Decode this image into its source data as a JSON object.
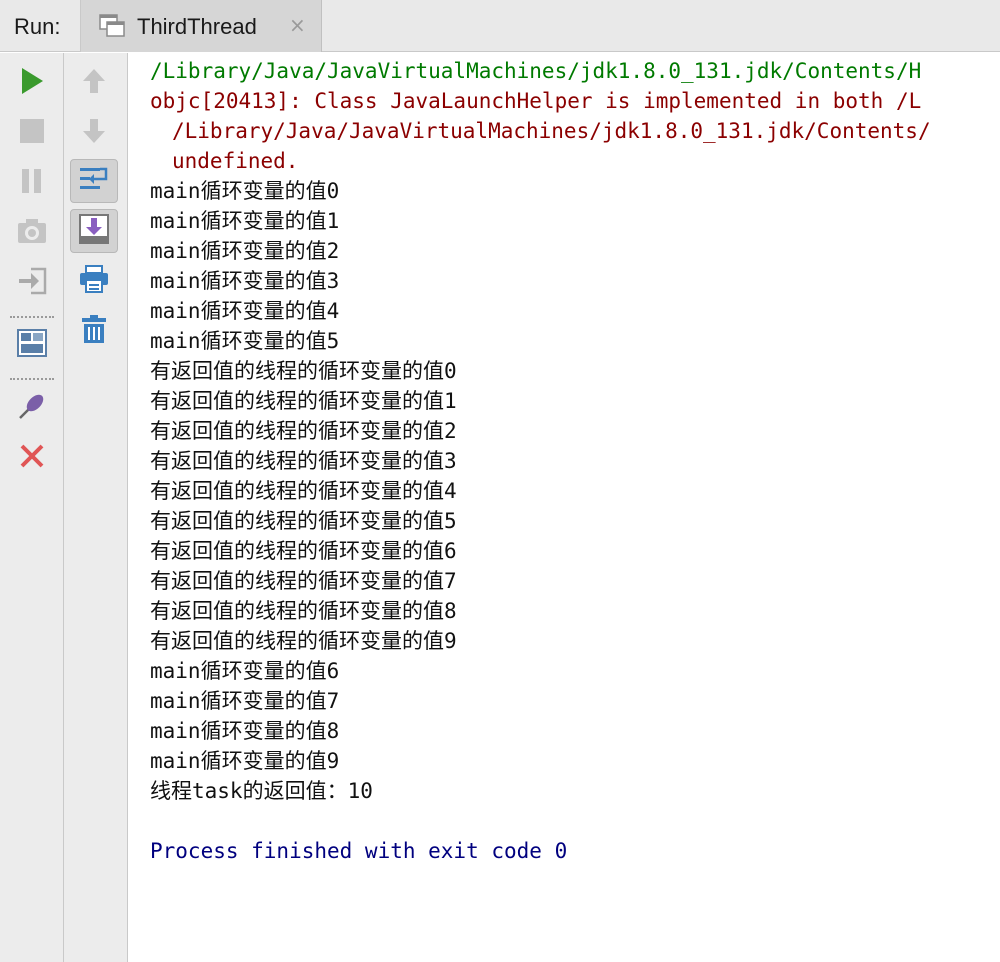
{
  "header": {
    "run_label": "Run:",
    "tab_title": "ThirdThread",
    "tab_close": "×",
    "tab_icon": "run-config-icon"
  },
  "toolbar_left": [
    {
      "icon": "rerun-icon",
      "color": "#3a9a2d"
    },
    {
      "icon": "stop-icon",
      "color": "#c8c8c8"
    },
    {
      "icon": "pause-icon",
      "color": "#c8c8c8"
    },
    {
      "icon": "camera-icon",
      "color": "#c8c8c8"
    },
    {
      "icon": "login-icon",
      "color": "#b0b0b0"
    },
    {
      "icon": "layout-icon",
      "color": "#5a7fa8"
    },
    {
      "icon": "pin-icon",
      "color": "#7b5fa8"
    },
    {
      "icon": "close-icon",
      "color": "#e05555"
    }
  ],
  "toolbar_right": [
    {
      "icon": "up-arrow-icon",
      "color": "#c8c8c8"
    },
    {
      "icon": "down-arrow-icon",
      "color": "#c8c8c8"
    },
    {
      "icon": "soft-wrap-icon",
      "color": "#3a7fc0",
      "toggled": true
    },
    {
      "icon": "scroll-to-end-icon",
      "color": "#8a5fc0",
      "toggled": true
    },
    {
      "icon": "print-icon",
      "color": "#3a7fc0"
    },
    {
      "icon": "trash-icon",
      "color": "#3a7fc0"
    }
  ],
  "console": {
    "colors": {
      "path": "#007a00",
      "error": "#8b0000",
      "normal": "#111111",
      "process": "#00007f"
    },
    "lines": [
      {
        "text": "/Library/Java/JavaVirtualMachines/jdk1.8.0_131.jdk/Contents/H",
        "kind": "path"
      },
      {
        "text": "objc[20413]: Class JavaLaunchHelper is implemented in both /L",
        "kind": "error"
      },
      {
        "text": "/Library/Java/JavaVirtualMachines/jdk1.8.0_131.jdk/Contents/",
        "kind": "error-indent"
      },
      {
        "text": "undefined.",
        "kind": "error-indent"
      },
      {
        "text": "main循环变量的值0",
        "kind": "normal"
      },
      {
        "text": "main循环变量的值1",
        "kind": "normal"
      },
      {
        "text": "main循环变量的值2",
        "kind": "normal"
      },
      {
        "text": "main循环变量的值3",
        "kind": "normal"
      },
      {
        "text": "main循环变量的值4",
        "kind": "normal"
      },
      {
        "text": "main循环变量的值5",
        "kind": "normal"
      },
      {
        "text": "有返回值的线程的循环变量的值0",
        "kind": "normal"
      },
      {
        "text": "有返回值的线程的循环变量的值1",
        "kind": "normal"
      },
      {
        "text": "有返回值的线程的循环变量的值2",
        "kind": "normal"
      },
      {
        "text": "有返回值的线程的循环变量的值3",
        "kind": "normal"
      },
      {
        "text": "有返回值的线程的循环变量的值4",
        "kind": "normal"
      },
      {
        "text": "有返回值的线程的循环变量的值5",
        "kind": "normal"
      },
      {
        "text": "有返回值的线程的循环变量的值6",
        "kind": "normal"
      },
      {
        "text": "有返回值的线程的循环变量的值7",
        "kind": "normal"
      },
      {
        "text": "有返回值的线程的循环变量的值8",
        "kind": "normal"
      },
      {
        "text": "有返回值的线程的循环变量的值9",
        "kind": "normal"
      },
      {
        "text": "main循环变量的值6",
        "kind": "normal"
      },
      {
        "text": "main循环变量的值7",
        "kind": "normal"
      },
      {
        "text": "main循环变量的值8",
        "kind": "normal"
      },
      {
        "text": "main循环变量的值9",
        "kind": "normal"
      },
      {
        "text": "线程task的返回值：10",
        "kind": "normal"
      },
      {
        "text": "",
        "kind": "normal"
      },
      {
        "text": "Process finished with exit code 0",
        "kind": "process"
      }
    ]
  }
}
